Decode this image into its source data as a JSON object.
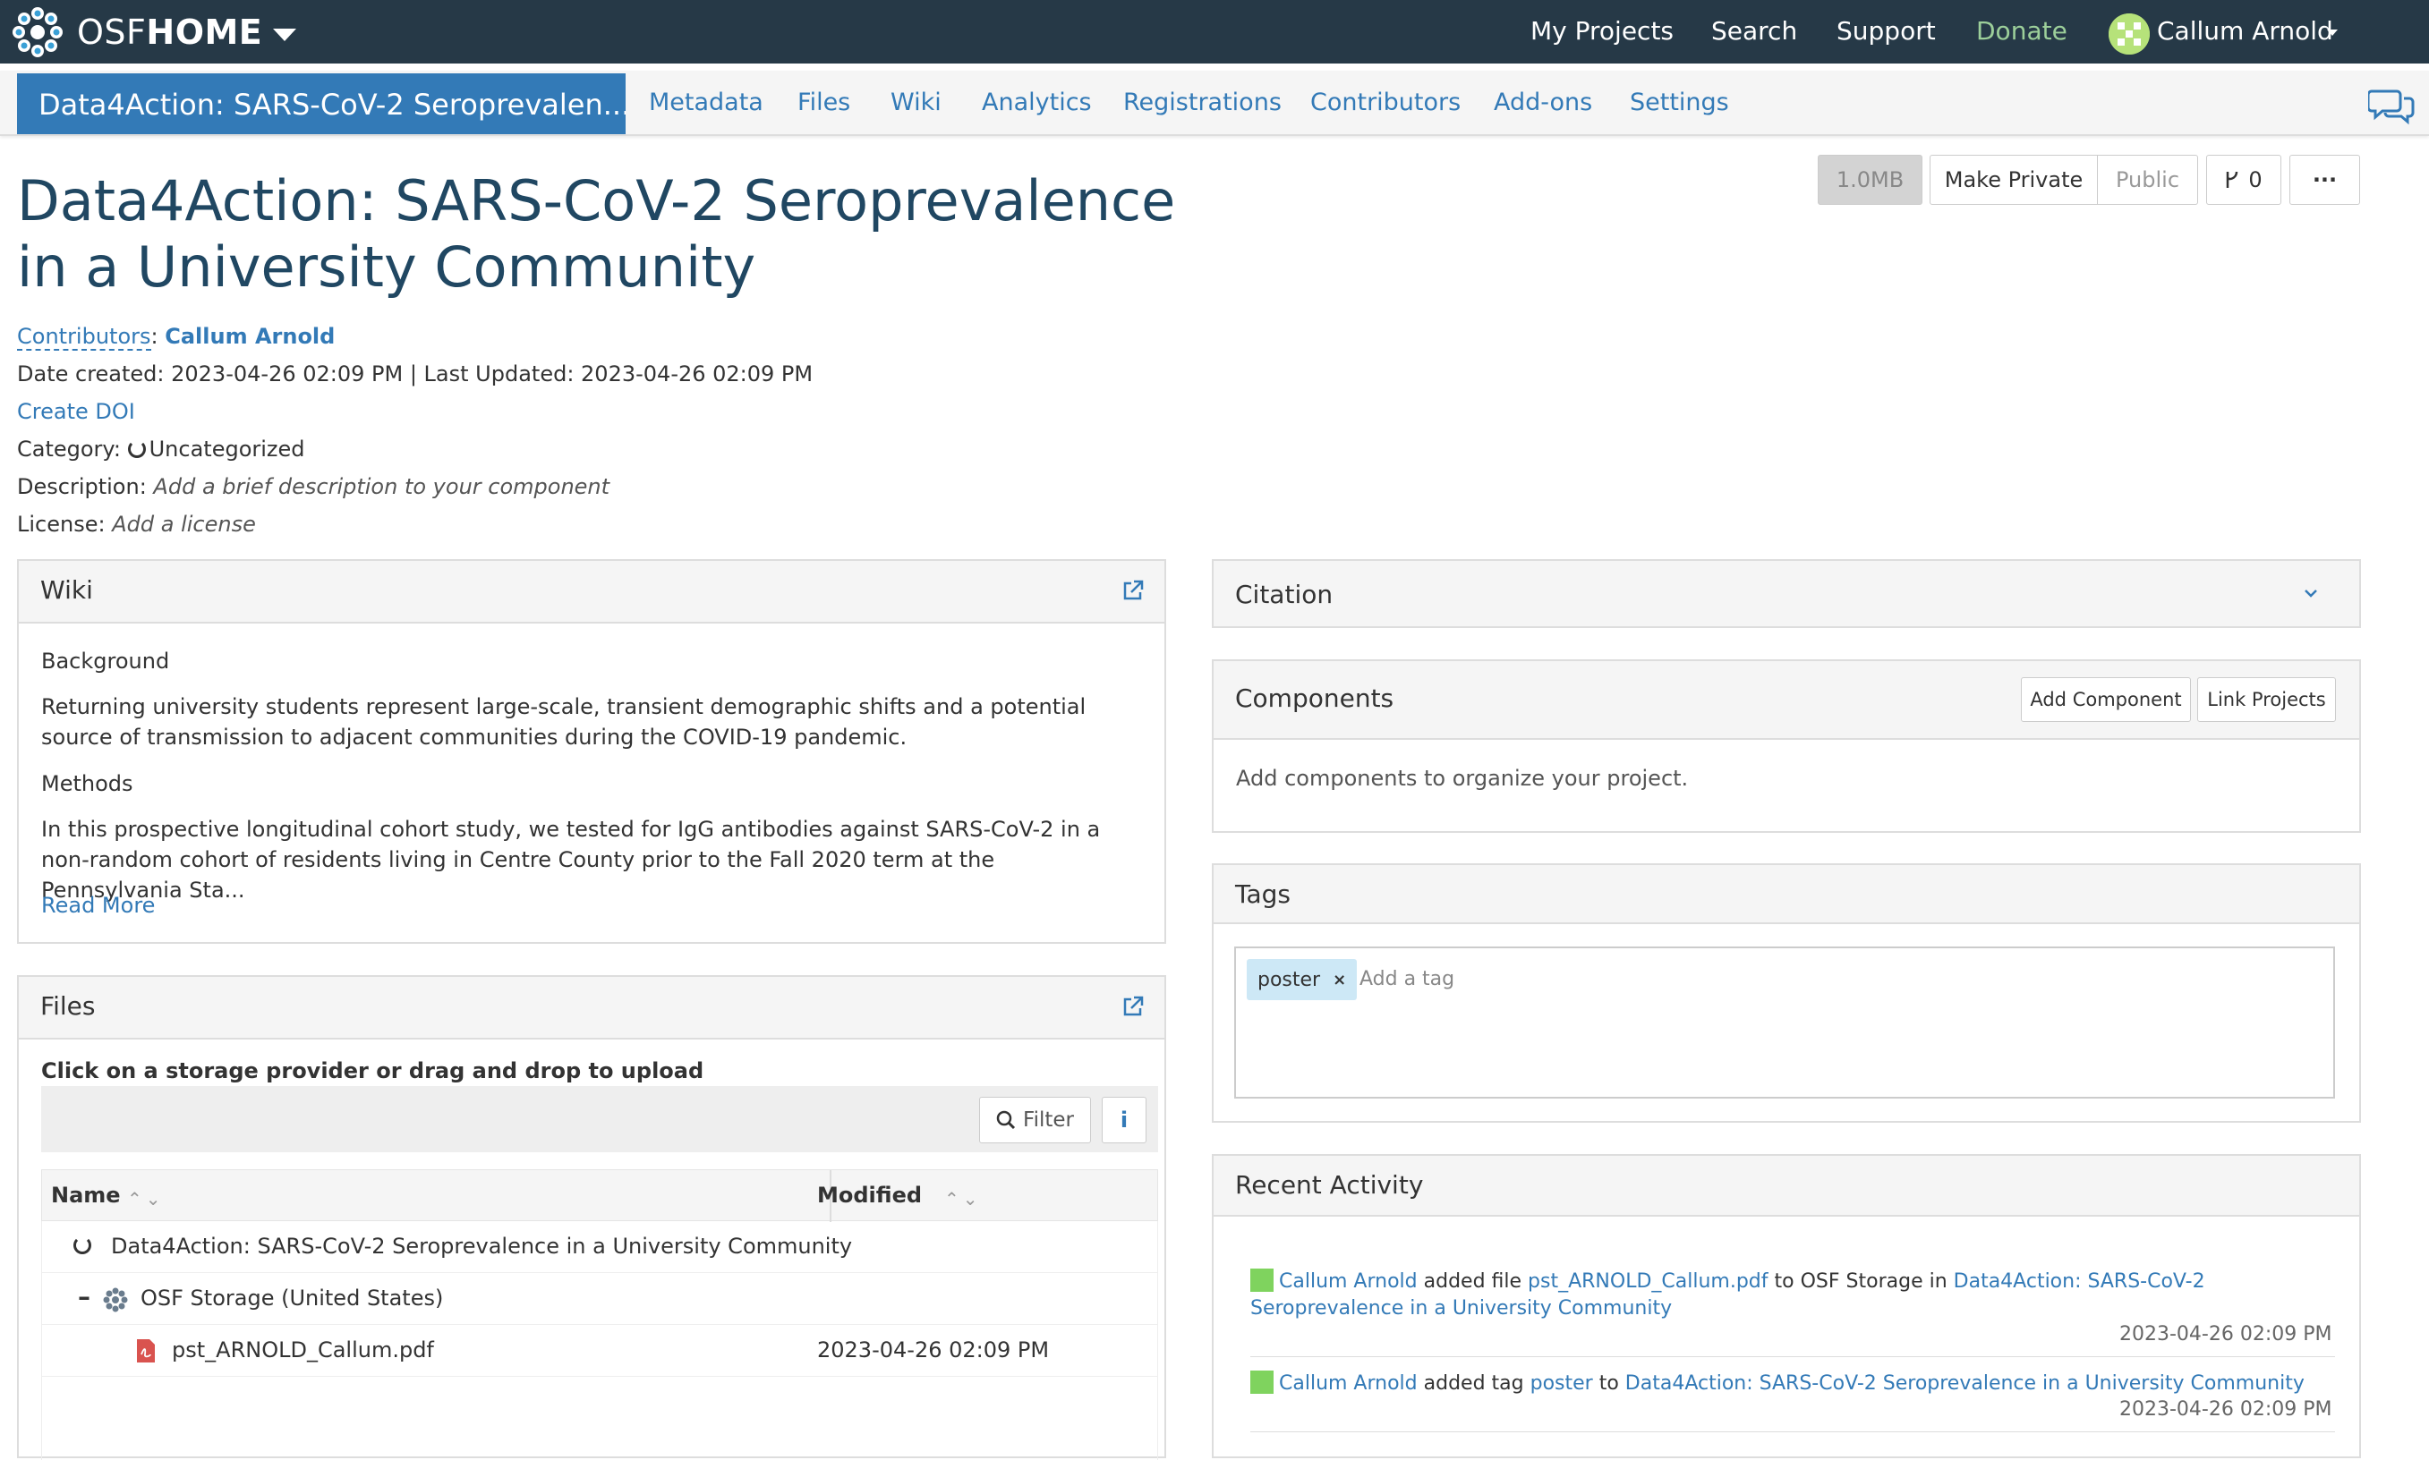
{
  "brand": {
    "osf": "OSF",
    "home": "HOME"
  },
  "topnav": {
    "my_projects": "My Projects",
    "search": "Search",
    "support": "Support",
    "donate": "Donate",
    "user_name": "Callum Arnold",
    "donate_color": "#9ccf9a"
  },
  "subnav": {
    "project_tab": "Data4Action: SARS-CoV-2 Seroprevalen...",
    "items": [
      "Metadata",
      "Files",
      "Wiki",
      "Analytics",
      "Registrations",
      "Contributors",
      "Add-ons",
      "Settings"
    ]
  },
  "project": {
    "title": "Data4Action: SARS-CoV-2 Seroprevalence in a University Community",
    "size_label": "1.0MB",
    "make_private": "Make Private",
    "public": "Public",
    "fork_count": "0",
    "more": "···",
    "contributors_label": "Contributors",
    "contributor_name": "Callum Arnold",
    "dates": "Date created: 2023-04-26 02:09 PM | Last Updated: 2023-04-26 02:09 PM",
    "create_doi": "Create DOI",
    "category_label": "Category:",
    "category_value": "Uncategorized",
    "description_label": "Description:",
    "description_value": "Add a brief description to your component",
    "license_label": "License:",
    "license_value": "Add a license"
  },
  "wiki": {
    "title": "Wiki",
    "heading_background": "Background",
    "background_text": "Returning university students represent large-scale, transient demographic shifts and a potential source of transmission to adjacent communities during the COVID-19 pandemic.",
    "heading_methods": "Methods",
    "methods_text": "In this prospective longitudinal cohort study, we tested for IgG antibodies against SARS-CoV-2 in a non-random cohort of residents living in Centre County prior to the Fall 2020 term at the Pennsylvania Sta...",
    "read_more": "Read More"
  },
  "files": {
    "title": "Files",
    "hint": "Click on a storage provider or drag and drop to upload",
    "filter": "Filter",
    "col_name": "Name",
    "col_modified": "Modified",
    "rows": [
      {
        "name": "Data4Action: SARS-CoV-2 Seroprevalence in a University Community",
        "modified": ""
      },
      {
        "name": "OSF Storage (United States)",
        "modified": ""
      },
      {
        "name": "pst_ARNOLD_Callum.pdf",
        "modified": "2023-04-26 02:09 PM"
      }
    ]
  },
  "citation": {
    "title": "Citation"
  },
  "components": {
    "title": "Components",
    "add_component": "Add Component",
    "link_projects": "Link Projects",
    "empty_text": "Add components to organize your project."
  },
  "tags": {
    "title": "Tags",
    "items": [
      "poster"
    ],
    "placeholder": "Add a tag"
  },
  "activity": {
    "title": "Recent Activity",
    "items": [
      {
        "user": "Callum Arnold",
        "action": "added file",
        "object": "pst_ARNOLD_Callum.pdf",
        "connector": "to OSF Storage in",
        "target": "Data4Action: SARS-CoV-2 Seroprevalence in a University Community",
        "time": "2023-04-26 02:09 PM"
      },
      {
        "user": "Callum Arnold",
        "action": "added tag",
        "object": "poster",
        "connector": "to",
        "target": "Data4Action: SARS-CoV-2 Seroprevalence in a University Community",
        "time": "2023-04-26 02:09 PM"
      }
    ]
  },
  "colors": {
    "navbar": "#263947",
    "accent": "#337ab7",
    "title": "#204762"
  }
}
